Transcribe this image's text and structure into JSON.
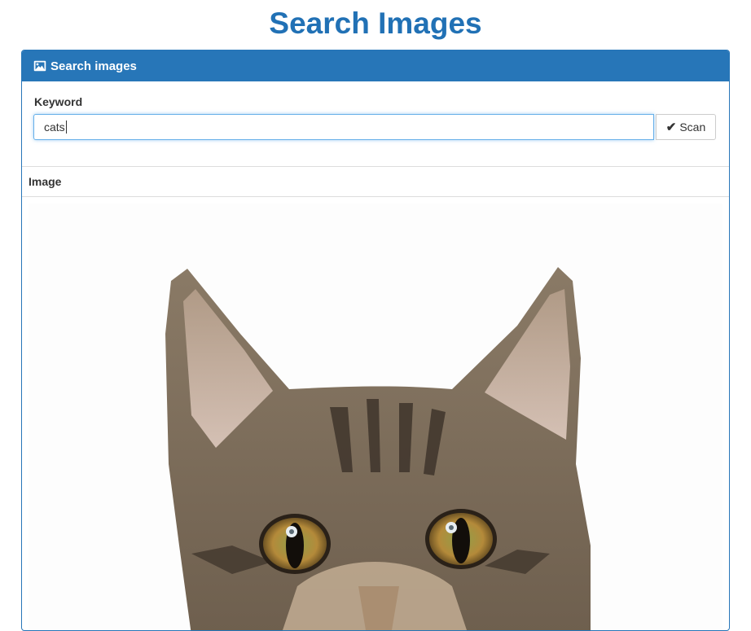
{
  "page": {
    "title": "Search Images"
  },
  "panel": {
    "heading": "Search images",
    "heading_icon": "image-icon",
    "accent_color": "#2776b8"
  },
  "form": {
    "keyword_label": "Keyword",
    "keyword_value": "cats",
    "scan_label": "Scan",
    "scan_icon": "check-icon"
  },
  "results": {
    "column_header": "Image",
    "image_subject": "tabby cat peeking up"
  }
}
